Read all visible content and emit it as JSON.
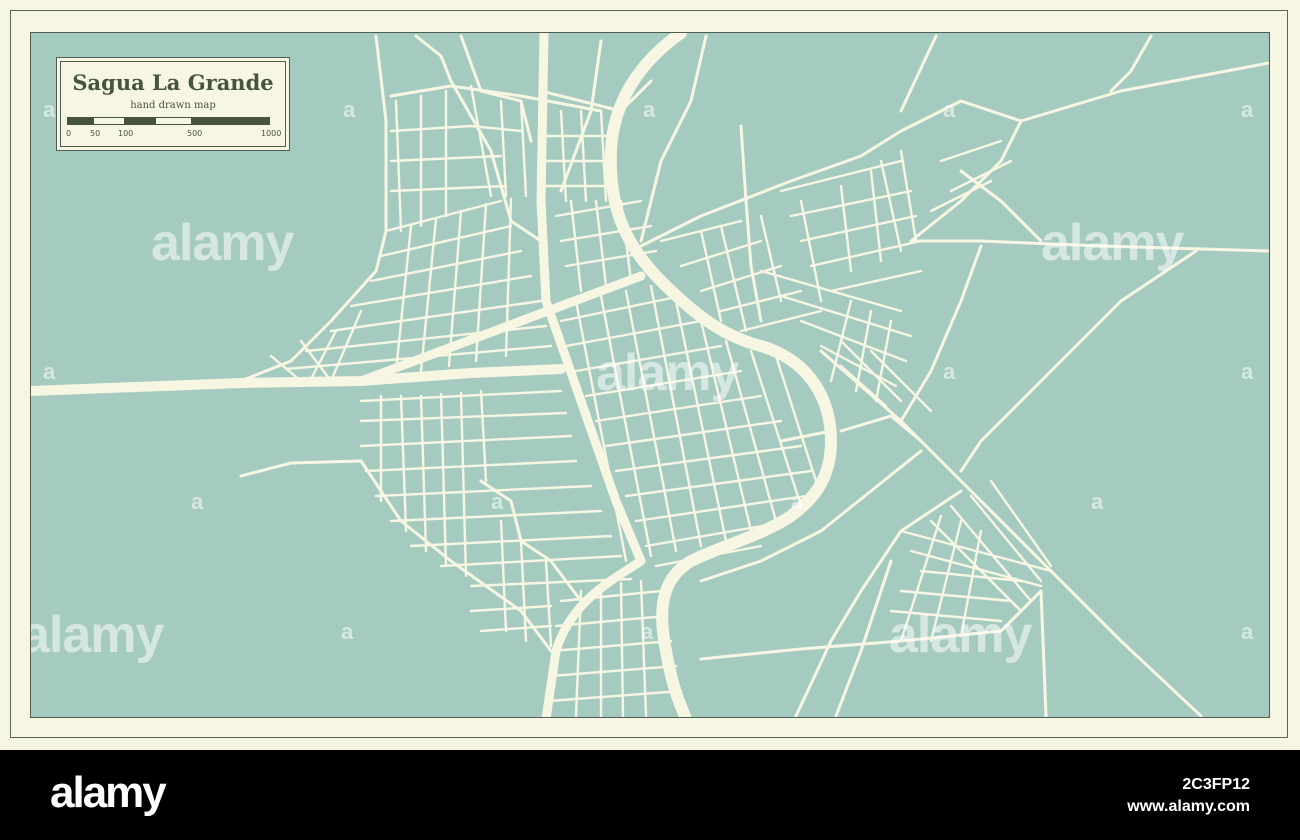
{
  "legend": {
    "title": "Sagua La Grande",
    "subtitle": "hand drawn map",
    "scale_labels": [
      "0",
      "50",
      "100",
      "500",
      "1000"
    ]
  },
  "watermark": {
    "text": "alamy",
    "letter": "a"
  },
  "footer": {
    "logo": "alamy",
    "image_id": "2C3FP12",
    "url": "www.alamy.com"
  },
  "colors": {
    "water": "#a5cbc1",
    "road": "#f7f6e2",
    "frame": "#f7f6e2",
    "ink": "#45543f"
  }
}
